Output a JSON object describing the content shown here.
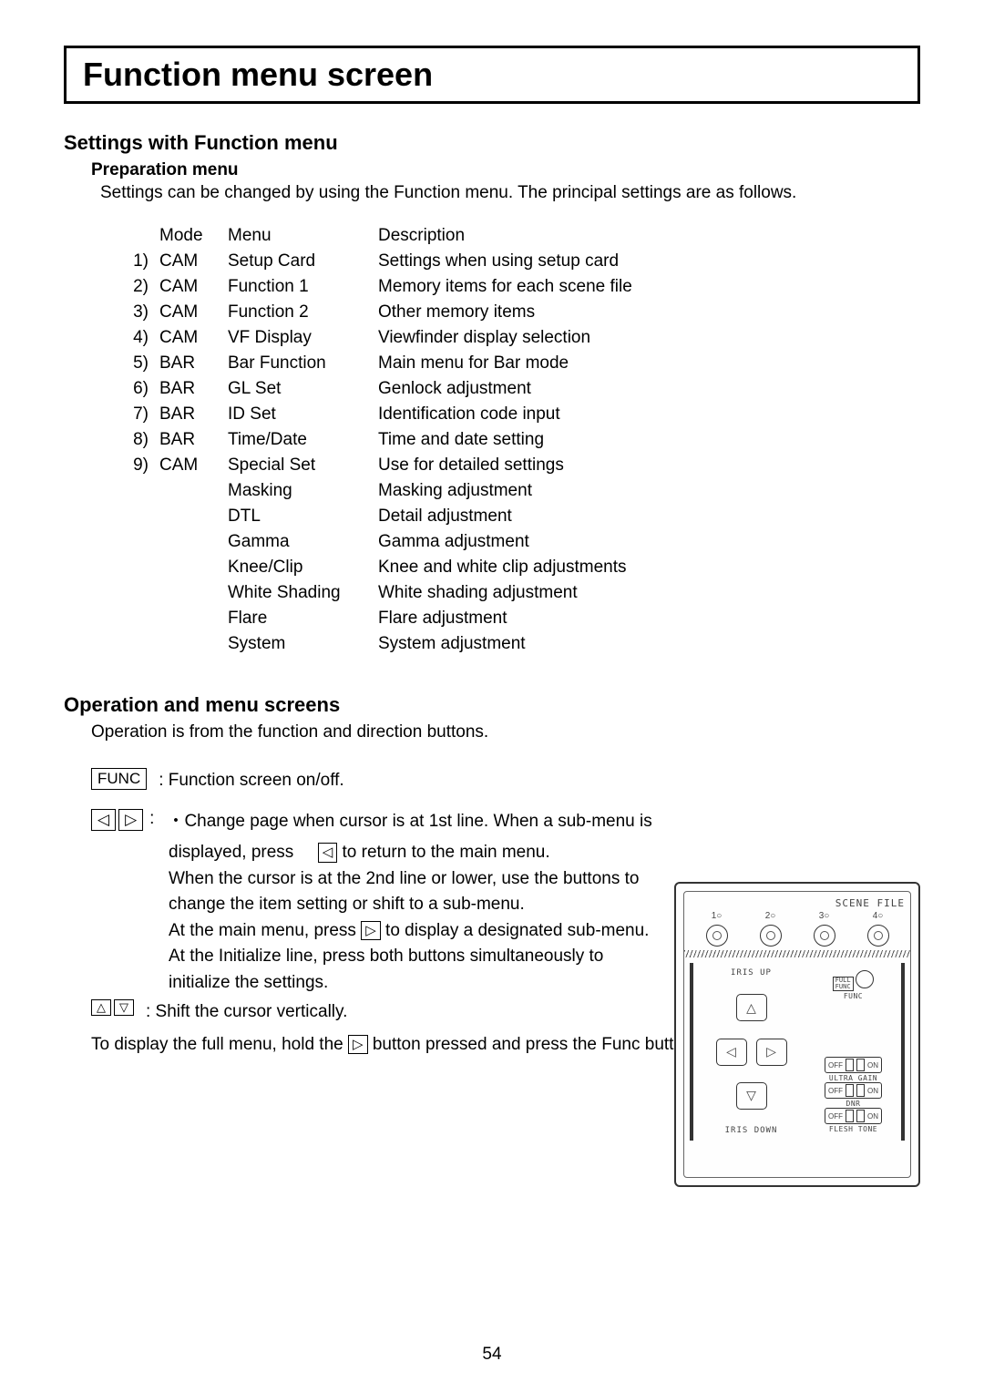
{
  "title": "Function menu screen",
  "section1": {
    "heading": "Settings with Function menu",
    "subheading": "Preparation menu",
    "intro": "Settings can be changed by using the Function menu.    The principal settings are as follows."
  },
  "table_header": {
    "mode": "Mode",
    "menu": "Menu",
    "desc": "Description"
  },
  "rows": [
    {
      "num": "1)",
      "mode": "CAM",
      "menu": "Setup Card",
      "desc": "Settings when using setup card"
    },
    {
      "num": "2)",
      "mode": "CAM",
      "menu": "Function 1",
      "desc": "Memory items for each scene file"
    },
    {
      "num": "3)",
      "mode": "CAM",
      "menu": "Function 2",
      "desc": "Other memory items"
    },
    {
      "num": "4)",
      "mode": "CAM",
      "menu": "VF Display",
      "desc": "Viewfinder display selection"
    },
    {
      "num": "5)",
      "mode": "BAR",
      "menu": "Bar Function",
      "desc": "Main menu for Bar mode"
    },
    {
      "num": "6)",
      "mode": "BAR",
      "menu": "GL Set",
      "desc": "Genlock adjustment"
    },
    {
      "num": "7)",
      "mode": "BAR",
      "menu": "ID Set",
      "desc": "Identification code input"
    },
    {
      "num": "8)",
      "mode": "BAR",
      "menu": "Time/Date",
      "desc": "Time and date setting"
    },
    {
      "num": "9)",
      "mode": "CAM",
      "menu": "Special Set",
      "desc": "Use for detailed settings"
    },
    {
      "num": "",
      "mode": "",
      "menu": "Masking",
      "desc": "Masking adjustment"
    },
    {
      "num": "",
      "mode": "",
      "menu": "DTL",
      "desc": "Detail adjustment"
    },
    {
      "num": "",
      "mode": "",
      "menu": "Gamma",
      "desc": "Gamma adjustment"
    },
    {
      "num": "",
      "mode": "",
      "menu": "Knee/Clip",
      "desc": "Knee and white clip adjustments"
    },
    {
      "num": "",
      "mode": "",
      "menu": "White Shading",
      "desc": "White shading adjustment"
    },
    {
      "num": "",
      "mode": "",
      "menu": "Flare",
      "desc": "Flare adjustment"
    },
    {
      "num": "",
      "mode": "",
      "menu": "System",
      "desc": "System adjustment"
    }
  ],
  "section2": {
    "heading": "Operation and menu screens",
    "intro": "Operation is from the function and direction buttons."
  },
  "keys": {
    "func": "FUNC",
    "left": "◁",
    "right": "▷",
    "up": "△",
    "down": "▽",
    "left_small": "◁"
  },
  "ops": {
    "func_desc": ": Function screen on/off.",
    "lr_line1a": "・Change page when cursor is at 1st line.    When a sub-menu is",
    "lr_line1b_pre": "displayed, press",
    "lr_line1b_post": "to return to the main menu.",
    "lr_line2": "When the cursor is at the 2nd line or lower, use the buttons to",
    "lr_line3": "change the item setting or shift to a sub-menu.",
    "lr_line4_pre": "At the main menu, press",
    "lr_line4_post": "to display a designated sub-menu.",
    "lr_line5": "At the Initialize line, press both buttons simultaneously to",
    "lr_line6": " initialize the settings.",
    "ud_desc": ": Shift the cursor vertically.",
    "full_pre": "To display the full menu, hold the",
    "full_post": "button pressed and press the Func button."
  },
  "panel": {
    "scene_file": "SCENE FILE",
    "scene_nums": [
      "1○",
      "2○",
      "3○",
      "4○"
    ],
    "iris_up": "IRIS UP",
    "iris_down": "IRIS DOWN",
    "full_func": "FULL\nFUNC",
    "func_label": "FUNC",
    "toggles": [
      {
        "off": "OFF",
        "on": "ON",
        "label": "ULTRA GAIN"
      },
      {
        "off": "OFF",
        "on": "ON",
        "label": "DNR"
      },
      {
        "off": "OFF",
        "on": "ON",
        "label": "FLESH TONE"
      }
    ]
  },
  "page_number": "54"
}
